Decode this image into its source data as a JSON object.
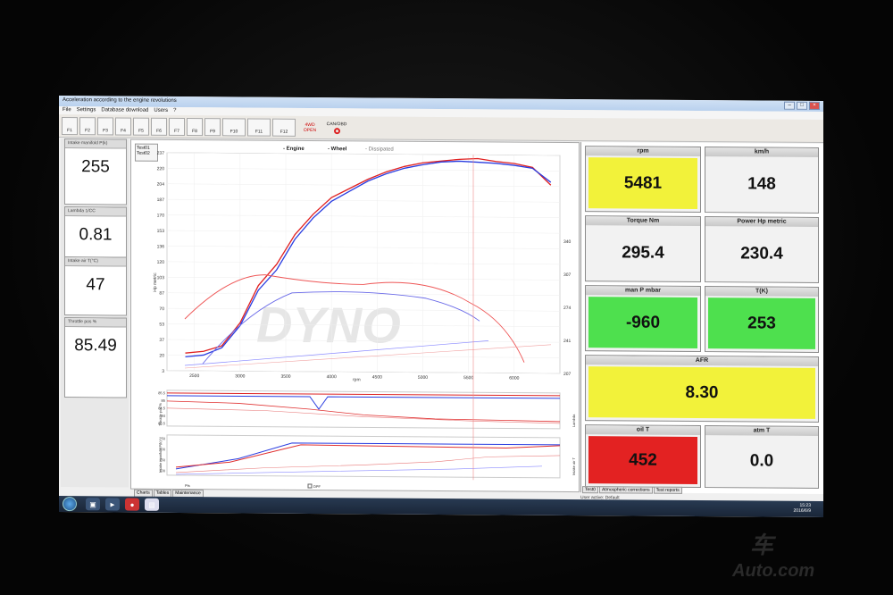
{
  "window": {
    "title": "Acceleration according to the engine revolutions"
  },
  "menu": [
    "File",
    "Settings",
    "Database download",
    "Users",
    "?"
  ],
  "toolbar": {
    "buttons": [
      "F1",
      "F2",
      "F3",
      "F4",
      "F5",
      "F6",
      "F7",
      "F8",
      "F9",
      "F10",
      "F11",
      "F12"
    ],
    "four_wd_text": "4WD",
    "open_text": "OPEN",
    "canobd_text": "CAN/OBD"
  },
  "left_gauges": [
    {
      "label": "Intake manifold P(k)",
      "value": "255"
    },
    {
      "label": "Lambda 1/CC",
      "value": "0.81"
    },
    {
      "label": "Intake air T(°C)",
      "value": "47"
    },
    {
      "label": "Throttle pos %",
      "value": "85.49"
    }
  ],
  "chart": {
    "legend": {
      "engine": "- Engine",
      "wheel": "- Wheel",
      "dissipated": "- Dissipated"
    },
    "legend_box": [
      "Test01",
      "Test02"
    ],
    "watermark": "DYNO",
    "y_left_label": "Hp metric",
    "y_left_ticks": [
      "237",
      "220",
      "204",
      "187",
      "170",
      "153",
      "136",
      "120",
      "103",
      "87",
      "70",
      "53",
      "37",
      "20",
      "3"
    ],
    "y_right_ticks": [
      "340",
      "307",
      "274",
      "241",
      "207"
    ],
    "x_ticks": [
      "2500",
      "3000",
      "3500",
      "4000",
      "4500",
      "5000",
      "5500",
      "6000"
    ],
    "x_label": "rpm",
    "sub1_label": "Throttle pos %",
    "sub1_ticks": [
      "85.5",
      "85",
      "84.5",
      "84",
      "83.5"
    ],
    "sub1_right": "Lambda",
    "sub2_label": "Intake manifold P(k)",
    "sub2_ticks": [
      "250",
      "200",
      "150",
      "100"
    ],
    "sub2_right": "Intake air T",
    "tabs": [
      "Charts",
      "Tables",
      "Maintenance"
    ],
    "bottom_labels": [
      "Pts",
      "DPF"
    ]
  },
  "chart_data": {
    "type": "line",
    "x": [
      2400,
      2600,
      2800,
      3000,
      3200,
      3400,
      3600,
      3800,
      4000,
      4200,
      4400,
      4600,
      4800,
      5000,
      5200,
      5400,
      5600,
      5800,
      6000,
      6200,
      6400
    ],
    "series": [
      {
        "name": "Engine",
        "values": [
          22,
          24,
          30,
          55,
          95,
          118,
          150,
          172,
          190,
          200,
          210,
          218,
          224,
          228,
          230,
          232,
          233,
          230,
          228,
          224,
          205
        ]
      },
      {
        "name": "Wheel",
        "values": [
          18,
          20,
          28,
          52,
          90,
          112,
          145,
          168,
          186,
          197,
          208,
          216,
          222,
          226,
          229,
          230,
          229,
          228,
          226,
          223,
          208
        ]
      }
    ],
    "xlim": [
      2200,
      6500
    ],
    "ylim": [
      3,
      237
    ],
    "xlabel": "rpm",
    "ylabel": "Hp metric"
  },
  "right_tiles": {
    "rpm": {
      "label": "rpm",
      "value": "5481",
      "color": "#f2f23a"
    },
    "kmh": {
      "label": "km/h",
      "value": "148",
      "color": "#f2f2f2"
    },
    "torque": {
      "label": "Torque Nm",
      "value": "295.4",
      "color": "#f2f2f2"
    },
    "power": {
      "label": "Power Hp metric",
      "value": "230.4",
      "color": "#f2f2f2"
    },
    "manp": {
      "label": "man P mbar",
      "value": "-960",
      "color": "#4ee04e"
    },
    "tk": {
      "label": "T(K)",
      "value": "253",
      "color": "#4ee04e"
    },
    "afr": {
      "label": "AFR",
      "value": "8.30",
      "color": "#f2f23a"
    },
    "oilt": {
      "label": "oil T",
      "value": "452",
      "color": "#e32222"
    },
    "atmt": {
      "label": "atm T",
      "value": "0.0",
      "color": "#f2f2f2"
    }
  },
  "right_tabs": [
    "Test0",
    "Atmospheric corrections",
    "Test reports"
  ],
  "status_text": "User active: Default",
  "clock": {
    "time": "15:23",
    "date": "2016/6/9"
  },
  "watermark_text": "车",
  "watermark_site": "Auto.com"
}
